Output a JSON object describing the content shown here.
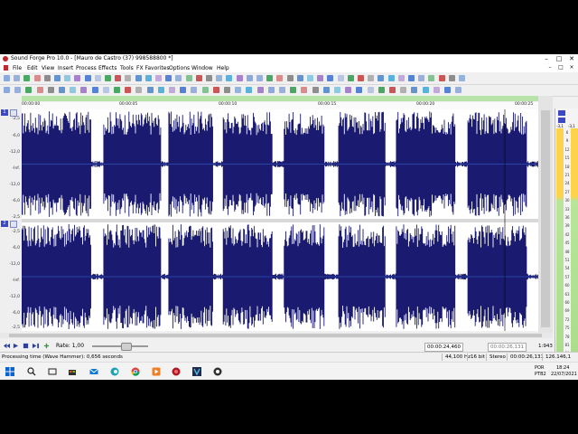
{
  "window": {
    "title": "Sound Forge Pro 10.0 - [Mauro de Castro (37) 998588800 *]",
    "controls": [
      "–",
      "□",
      "✕"
    ]
  },
  "menu": {
    "items": [
      "File",
      "Edit",
      "View",
      "Insert",
      "Process",
      "Effects",
      "Tools",
      "FX Favorites",
      "Options",
      "Window",
      "Help"
    ],
    "doc_controls": [
      "–",
      "□",
      "×"
    ]
  },
  "ruler": {
    "ticks": [
      "00:00:00",
      "00:00:05",
      "00:00:10",
      "00:00:15",
      "00:00:20",
      "00:00:25"
    ]
  },
  "channels": {
    "ids": [
      "1",
      "2"
    ],
    "db_labels": [
      "-2,5",
      "-6,0",
      "-12,0",
      "-Inf.",
      "-12,0",
      "-6,0",
      "-2,5"
    ]
  },
  "waveform": {
    "color": "#1a1a70",
    "bursts": [
      [
        0,
        3.9
      ],
      [
        4.55,
        7.8
      ],
      [
        8.2,
        10.7
      ],
      [
        11.25,
        14.0
      ],
      [
        14.65,
        16.9
      ],
      [
        17.7,
        20.3
      ],
      [
        20.9,
        24.2
      ],
      [
        24.9,
        28.2
      ]
    ],
    "duration_sec": 28.85
  },
  "transport": {
    "rate_label": "Rate:",
    "rate_value": "1,00",
    "selection_start": "00:00:24,460",
    "selection_end": "00:00:26,131",
    "zoom": "1:943"
  },
  "status": {
    "processing": "Processing time (Wave Hammer): 0,656 seconds",
    "sample_rate": "44,100 Hz",
    "bit_depth": "16 bit",
    "channels": "Stereo",
    "length": "00:00:26,131",
    "disk": "126.146,1 MB"
  },
  "meter": {
    "header_left": "-3,1",
    "header_right": "-3,1",
    "scale": [
      "6",
      "9",
      "12",
      "15",
      "18",
      "21",
      "24",
      "27",
      "30",
      "33",
      "36",
      "39",
      "42",
      "45",
      "48",
      "51",
      "54",
      "57",
      "60",
      "63",
      "66",
      "69",
      "72",
      "75",
      "78",
      "81",
      "84",
      "87"
    ]
  },
  "taskbar": {
    "lang": "POR",
    "lang_sub": "PTB2",
    "time": "18:24",
    "date": "22/07/2021"
  }
}
